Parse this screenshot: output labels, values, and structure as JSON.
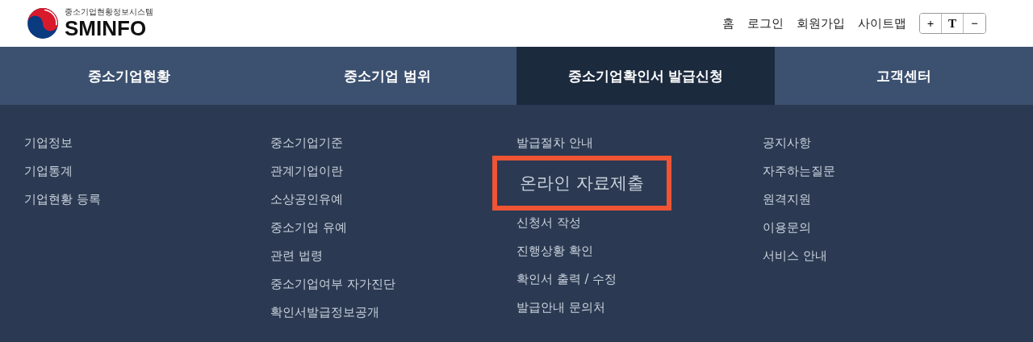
{
  "logo": {
    "subtitle": "중소기업현황정보시스템",
    "name": "SMINFO"
  },
  "top_links": [
    "홈",
    "로그인",
    "회원가입",
    "사이트맵"
  ],
  "font_controls": [
    "+",
    "T",
    "−"
  ],
  "tabs": [
    {
      "label": "중소기업현황",
      "selected": false
    },
    {
      "label": "중소기업 범위",
      "selected": false
    },
    {
      "label": "중소기업확인서 발급신청",
      "selected": true
    },
    {
      "label": "고객센터",
      "selected": false
    }
  ],
  "menu_columns": [
    [
      {
        "label": "기업정보",
        "highlighted": false
      },
      {
        "label": "기업통계",
        "highlighted": false
      },
      {
        "label": "기업현황 등록",
        "highlighted": false
      }
    ],
    [
      {
        "label": "중소기업기준",
        "highlighted": false
      },
      {
        "label": "관계기업이란",
        "highlighted": false
      },
      {
        "label": "소상공인유예",
        "highlighted": false
      },
      {
        "label": "중소기업 유예",
        "highlighted": false
      },
      {
        "label": "관련 법령",
        "highlighted": false
      },
      {
        "label": "중소기업여부 자가진단",
        "highlighted": false
      },
      {
        "label": "확인서발급정보공개",
        "highlighted": false
      }
    ],
    [
      {
        "label": "발급절차 안내",
        "highlighted": false
      },
      {
        "label": "온라인 자료제출",
        "highlighted": true
      },
      {
        "label": "신청서 작성",
        "highlighted": false
      },
      {
        "label": "진행상황 확인",
        "highlighted": false
      },
      {
        "label": "확인서 출력 / 수정",
        "highlighted": false
      },
      {
        "label": "발급안내 문의처",
        "highlighted": false
      }
    ],
    [
      {
        "label": "공지사항",
        "highlighted": false
      },
      {
        "label": "자주하는질문",
        "highlighted": false
      },
      {
        "label": "원격지원",
        "highlighted": false
      },
      {
        "label": "이용문의",
        "highlighted": false
      },
      {
        "label": "서비스 안내",
        "highlighted": false
      }
    ]
  ]
}
